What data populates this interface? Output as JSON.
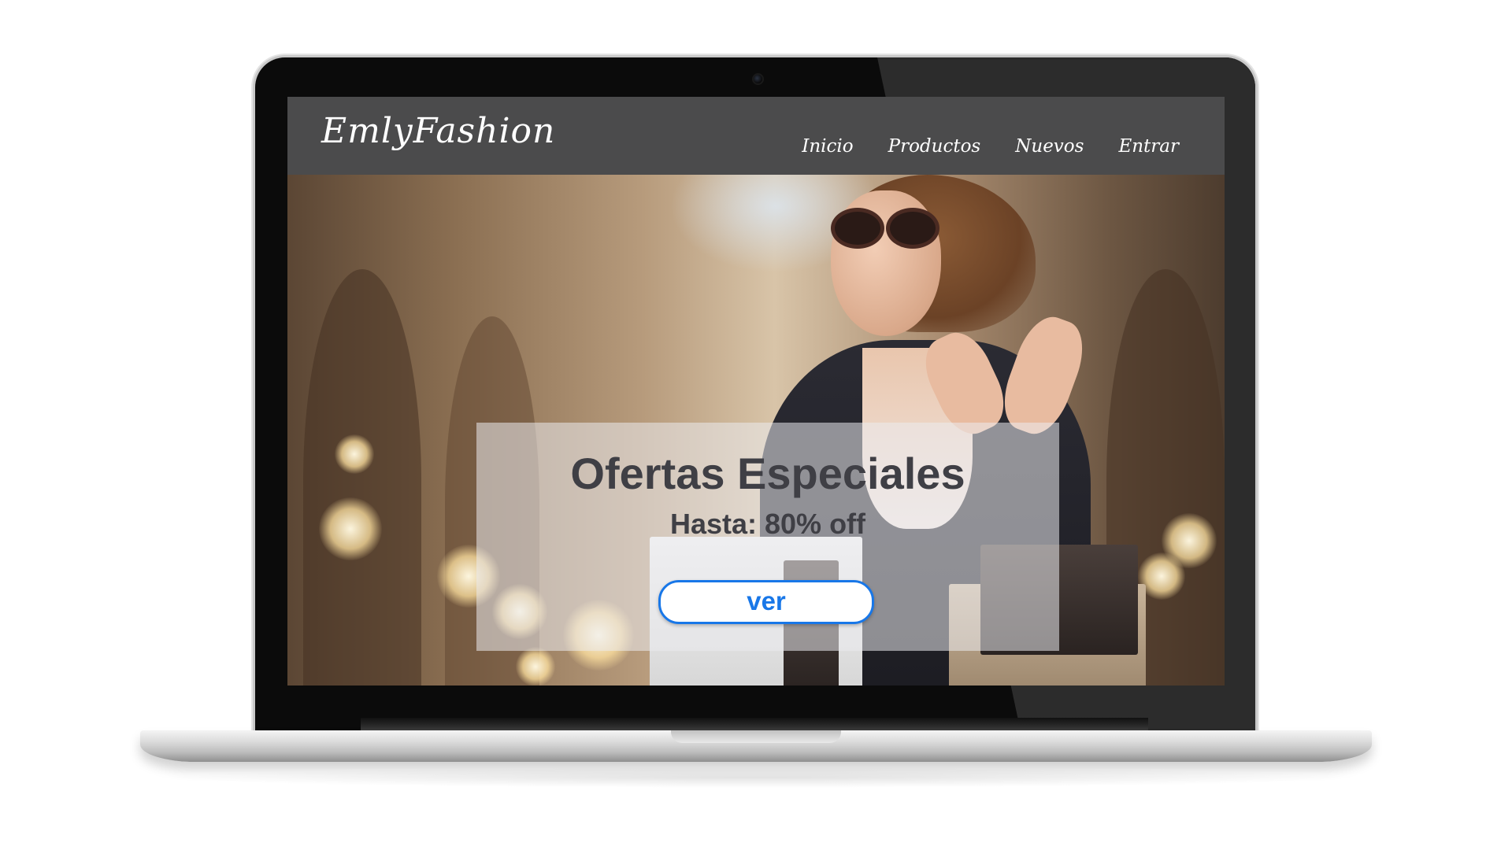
{
  "site": {
    "logo": "EmlyFashion"
  },
  "nav": {
    "items": [
      {
        "label": "Inicio"
      },
      {
        "label": "Productos"
      },
      {
        "label": "Nuevos"
      },
      {
        "label": "Entrar"
      }
    ]
  },
  "hero": {
    "title": "Ofertas Especiales",
    "subtitle": "Hasta: 80% off",
    "button_label": "ver"
  },
  "colors": {
    "nav_background": "#4b4b4c",
    "button_accent": "#1877e8",
    "heading_text": "#3f3f45"
  }
}
